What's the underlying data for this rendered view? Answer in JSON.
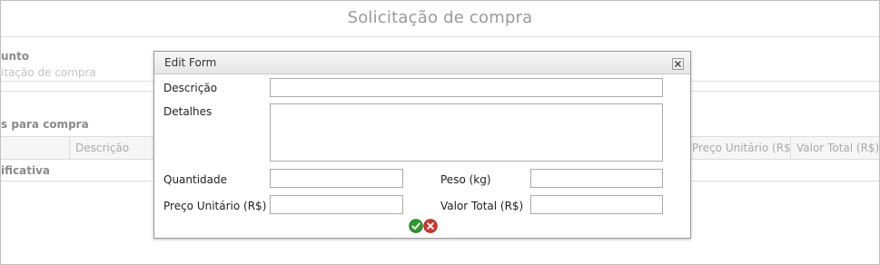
{
  "page": {
    "title": "Solicitação de compra",
    "section_label_1": "unto",
    "section_value_1": "itação de compra",
    "section_label_2": "s para compra",
    "section_label_3": "ificativa"
  },
  "grid": {
    "columns": [
      "Descrição",
      "Preço Unitário (R$)",
      "Valor Total (R$)"
    ]
  },
  "modal": {
    "title": "Edit Form",
    "fields": {
      "descricao": {
        "label": "Descrição",
        "value": ""
      },
      "detalhes": {
        "label": "Detalhes",
        "value": ""
      },
      "quantidade": {
        "label": "Quantidade",
        "value": ""
      },
      "peso": {
        "label": "Peso (kg)",
        "value": ""
      },
      "preco_unitario": {
        "label": "Preço Unitário (R$)",
        "value": ""
      },
      "valor_total": {
        "label": "Valor Total (R$)",
        "value": ""
      }
    },
    "icons": {
      "close": "close-icon",
      "confirm": "check-icon",
      "cancel": "cancel-icon"
    }
  },
  "colors": {
    "confirm_green": "#2e9a2e",
    "cancel_red": "#d9342b"
  }
}
